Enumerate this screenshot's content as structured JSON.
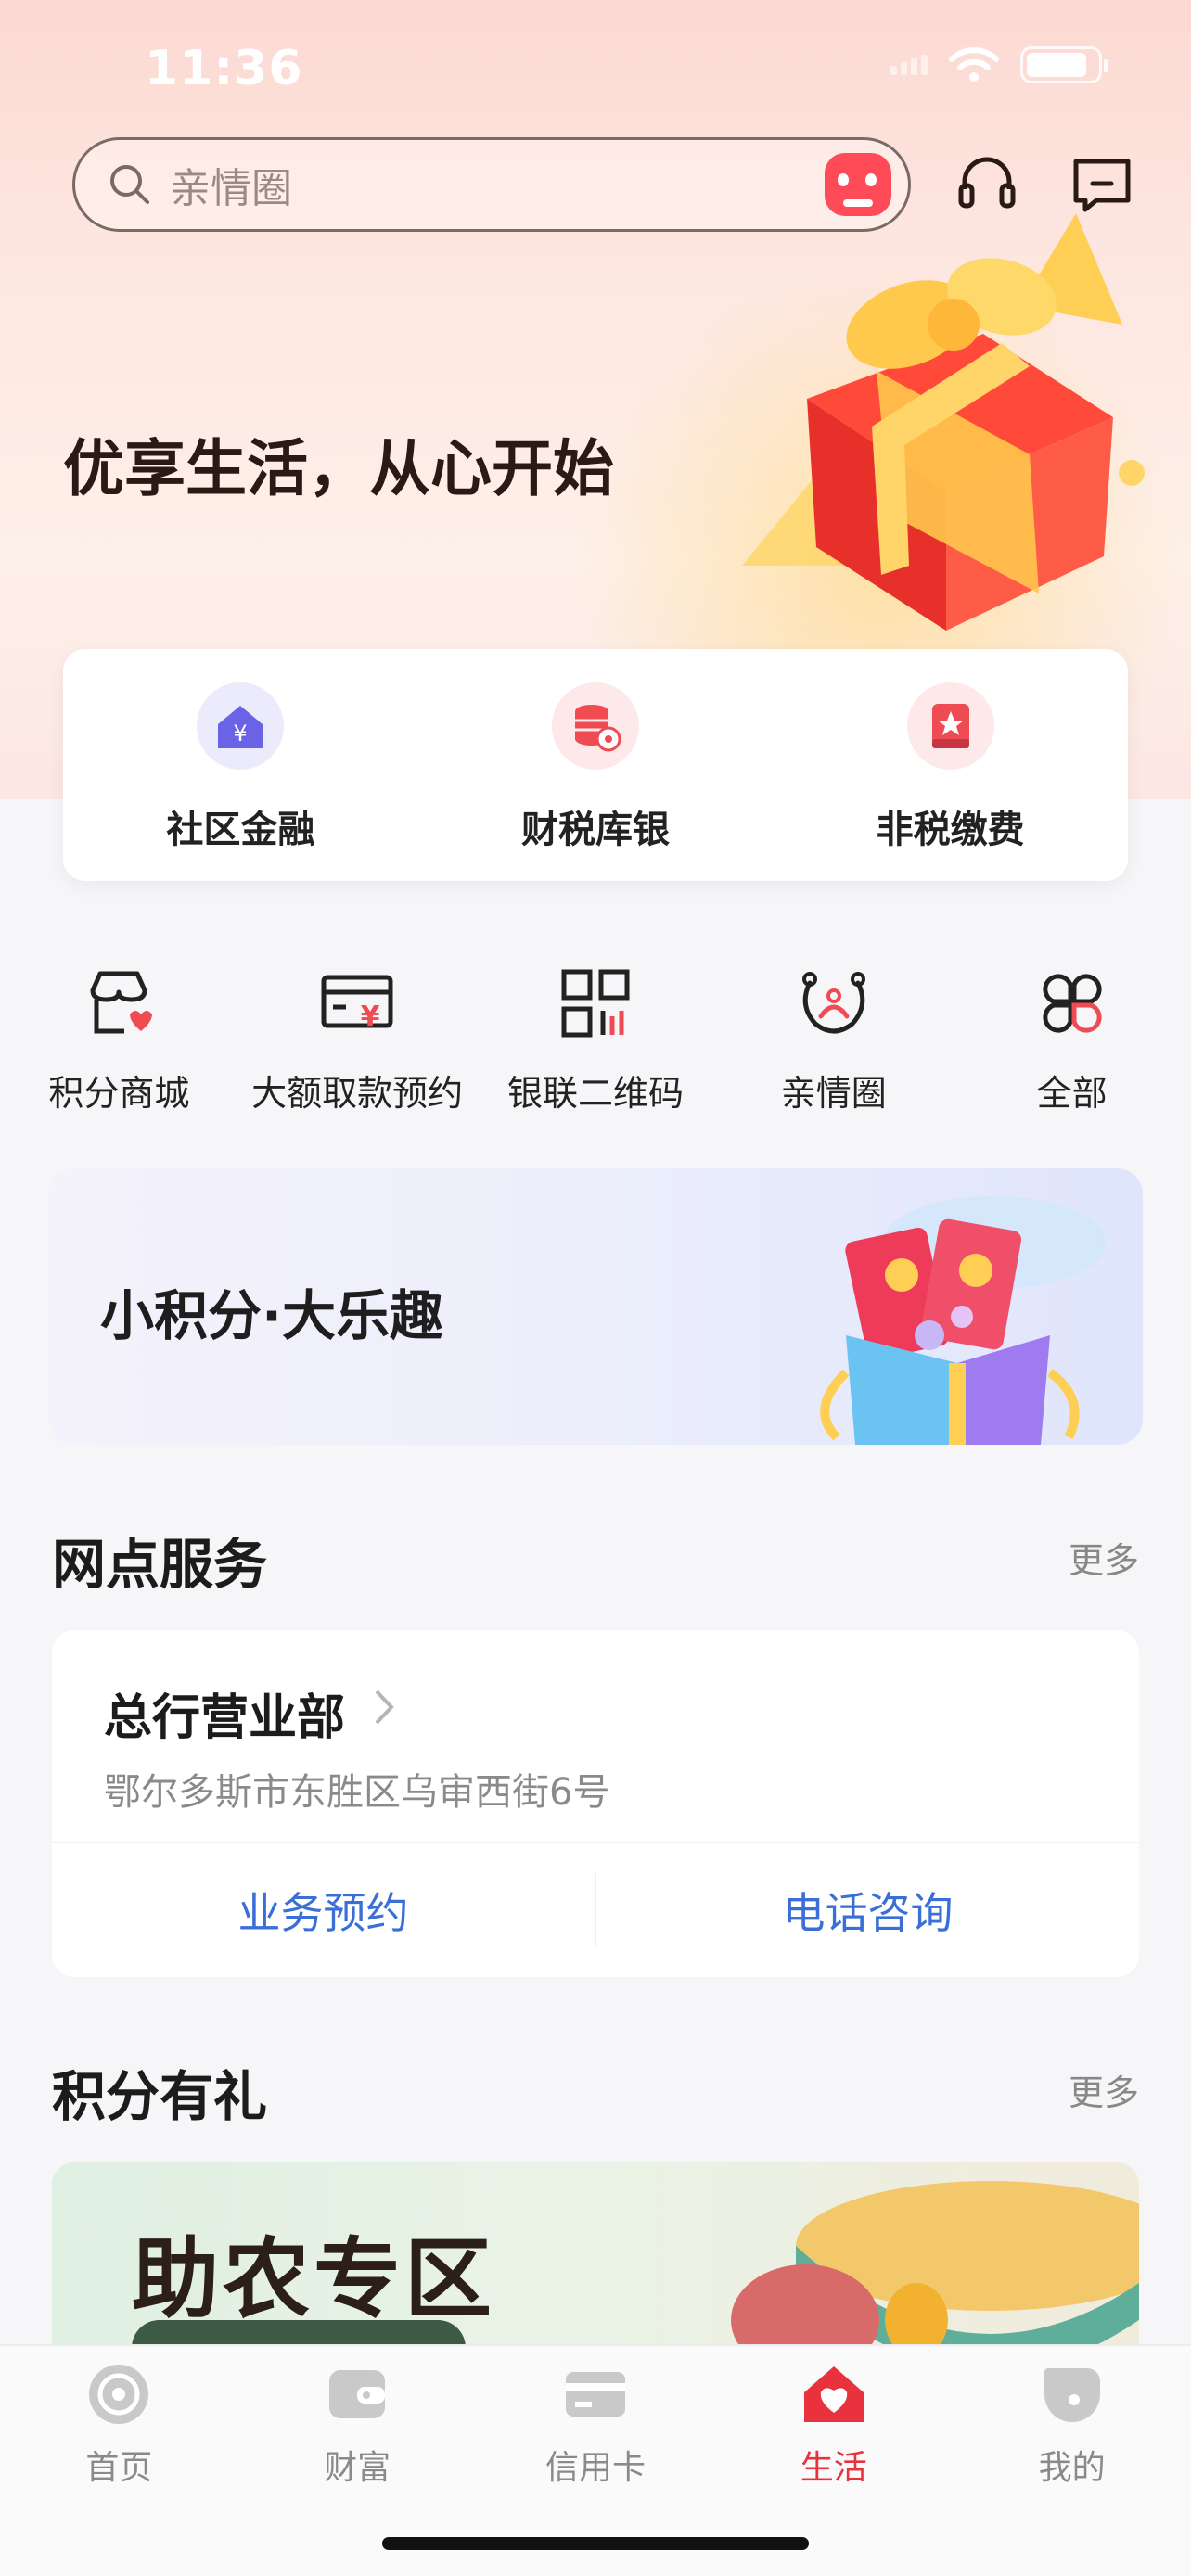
{
  "status": {
    "time": "11:36"
  },
  "search": {
    "placeholder": "亲情圈"
  },
  "hero": {
    "slogan": "优享生活，从心开始"
  },
  "quick_services": [
    {
      "label": "社区金融",
      "icon": "community-finance-icon",
      "color": "#6b63e6"
    },
    {
      "label": "财税库银",
      "icon": "tax-treasury-icon",
      "color": "#ee4b53"
    },
    {
      "label": "非税缴费",
      "icon": "non-tax-payment-icon",
      "color": "#ee4b53"
    }
  ],
  "grid": [
    {
      "label": "积分商城",
      "icon": "points-mall-icon"
    },
    {
      "label": "大额取款预约",
      "icon": "large-withdrawal-icon"
    },
    {
      "label": "银联二维码",
      "icon": "unionpay-qr-icon"
    },
    {
      "label": "亲情圈",
      "icon": "family-circle-icon"
    },
    {
      "label": "全部",
      "icon": "all-services-icon"
    }
  ],
  "banner": {
    "text": "小积分·大乐趣"
  },
  "branch_section": {
    "title": "网点服务",
    "more": "更多"
  },
  "branch": {
    "name": "总行营业部",
    "address": "鄂尔多斯市东胜区乌审西街6号",
    "actions": [
      "业务预约",
      "电话咨询"
    ]
  },
  "points_section": {
    "title": "积分有礼",
    "more": "更多"
  },
  "promo": {
    "title": "助农专区"
  },
  "tabbar": {
    "active": 3,
    "tabs": [
      {
        "label": "首页",
        "icon": "home-icon"
      },
      {
        "label": "财富",
        "icon": "wallet-icon"
      },
      {
        "label": "信用卡",
        "icon": "credit-card-icon"
      },
      {
        "label": "生活",
        "icon": "life-icon"
      },
      {
        "label": "我的",
        "icon": "profile-icon"
      }
    ]
  },
  "colors": {
    "accent": "#e8323e",
    "link": "#3a6fd8"
  }
}
